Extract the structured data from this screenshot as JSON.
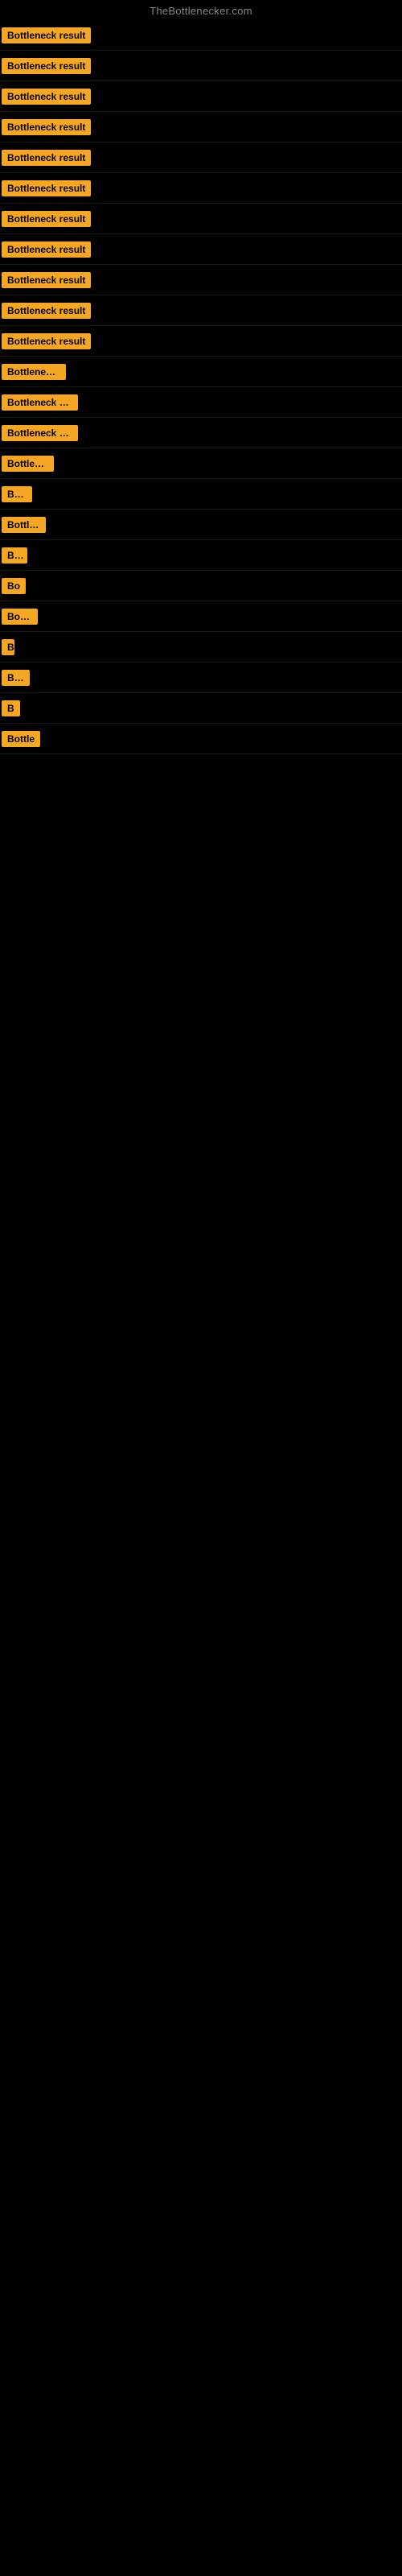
{
  "site": {
    "title": "TheBottlenecker.com"
  },
  "rows": [
    {
      "id": 1,
      "label": "Bottleneck result",
      "visible_chars": 16
    },
    {
      "id": 2,
      "label": "Bottleneck result",
      "visible_chars": 16
    },
    {
      "id": 3,
      "label": "Bottleneck result",
      "visible_chars": 16
    },
    {
      "id": 4,
      "label": "Bottleneck result",
      "visible_chars": 16
    },
    {
      "id": 5,
      "label": "Bottleneck result",
      "visible_chars": 16
    },
    {
      "id": 6,
      "label": "Bottleneck result",
      "visible_chars": 16
    },
    {
      "id": 7,
      "label": "Bottleneck result",
      "visible_chars": 16
    },
    {
      "id": 8,
      "label": "Bottleneck result",
      "visible_chars": 16
    },
    {
      "id": 9,
      "label": "Bottleneck result",
      "visible_chars": 16
    },
    {
      "id": 10,
      "label": "Bottleneck result",
      "visible_chars": 16
    },
    {
      "id": 11,
      "label": "Bottleneck result",
      "visible_chars": 16
    },
    {
      "id": 12,
      "label": "Bottleneck resul",
      "visible_chars": 15
    },
    {
      "id": 13,
      "label": "Bottleneck result",
      "visible_chars": 16
    },
    {
      "id": 14,
      "label": "Bottleneck result",
      "visible_chars": 16
    },
    {
      "id": 15,
      "label": "Bottleneck r",
      "visible_chars": 12
    },
    {
      "id": 16,
      "label": "Bottlen",
      "visible_chars": 7
    },
    {
      "id": 17,
      "label": "Bottleneck",
      "visible_chars": 10
    },
    {
      "id": 18,
      "label": "Bottle",
      "visible_chars": 6
    },
    {
      "id": 19,
      "label": "Bo",
      "visible_chars": 2
    },
    {
      "id": 20,
      "label": "Bottle",
      "visible_chars": 6
    },
    {
      "id": 21,
      "label": "Bott",
      "visible_chars": 4
    },
    {
      "id": 22,
      "label": "Bottlene",
      "visible_chars": 8
    },
    {
      "id": 23,
      "label": "B",
      "visible_chars": 1
    },
    {
      "id": 24,
      "label": "Bottle",
      "visible_chars": 6
    }
  ],
  "colors": {
    "badge_bg": "#f5a623",
    "badge_text": "#000000",
    "background": "#000000",
    "title": "#888888"
  }
}
